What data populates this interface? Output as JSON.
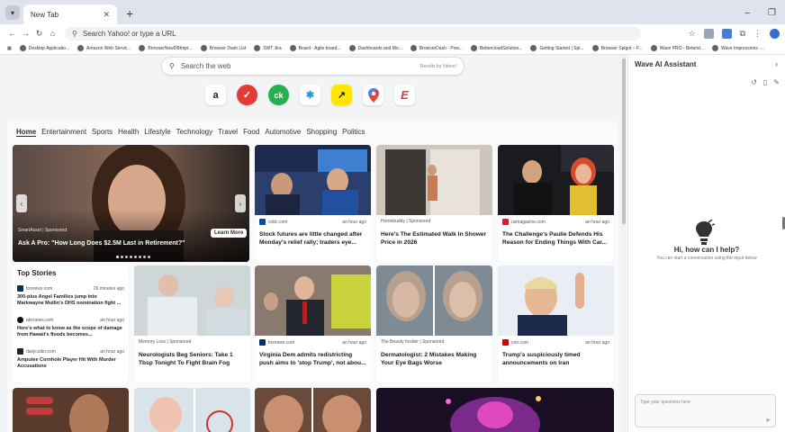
{
  "browser": {
    "tab_title": "New Tab",
    "address_placeholder": "Search Yahoo! or type a URL"
  },
  "bookmarks": [
    "Desktop Applicatio...",
    "Amazon Web Servic...",
    "BrowserNewDBImpr...",
    "Browser Dash List",
    "SWT Jira",
    "Board - Agile board...",
    "Dashboards and Mo...",
    "BrowserDash - Pow...",
    "BettercloudSolution...",
    "Getting Started | Spl...",
    "Browser Spigot – F...",
    "Wave PRO - Betend...",
    "Wave Impressions -..."
  ],
  "search": {
    "placeholder": "Search the web",
    "results_by": "Results by Yahoo!"
  },
  "shortcuts": [
    {
      "name": "amazon",
      "glyph": "a",
      "color": "#111111"
    },
    {
      "name": "todoist",
      "glyph": "✓",
      "color": "#ffffff"
    },
    {
      "name": "checkmate",
      "glyph": "ck",
      "color": "#ffffff"
    },
    {
      "name": "walmart",
      "glyph": "✱",
      "color": "#1a9ad6"
    },
    {
      "name": "arrow-app",
      "glyph": "↗",
      "color": "#111111"
    },
    {
      "name": "google-maps",
      "glyph": "⬤",
      "color": "#34a853"
    },
    {
      "name": "e-app",
      "glyph": "E",
      "color": "#e53935"
    }
  ],
  "categories": [
    "Home",
    "Entertainment",
    "Sports",
    "Health",
    "Lifestyle",
    "Technology",
    "Travel",
    "Food",
    "Automotive",
    "Shopping",
    "Politics"
  ],
  "hero": {
    "source": "SmartAsset | Sponsored",
    "title": "Ask A Pro: \"How Long Does $2.5M Last in Retirement?\"",
    "button": "Learn More"
  },
  "cards_row1": [
    {
      "source": "cnbc.com",
      "time": "an hour ago",
      "title": "Stock futures are little changed after Monday's relief rally; traders eye..."
    },
    {
      "source": "Homebuddy | Sponsored",
      "time": "",
      "title": "Here's The Estimated Walk In Shower Price in 2026"
    },
    {
      "source": "usmagazine.com",
      "time": "an hour ago",
      "title": "The Challenge's Paulie Defends His Reason for Ending Things With Car..."
    }
  ],
  "top_stories": {
    "title": "Top Stories",
    "items": [
      {
        "source": "foxnews.com",
        "time": "26 minutes ago",
        "title": "300-plus Angel Families jump into Markwayne Mullin's DHS nomination fight ..."
      },
      {
        "source": "abcnews.com",
        "time": "an hour ago",
        "title": "Here's what to know as the scope of damage from Hawaii's floods becomes..."
      },
      {
        "source": "dailycaller.com",
        "time": "an hour ago",
        "title": "Amputee Cornhole Player Hit With Murder Accusations"
      }
    ]
  },
  "cards_row2": [
    {
      "source": "Memory Loss | Sponsored",
      "time": "",
      "title": "Neurologists Beg Seniors: Take 1 Tbsp Tonight To Fight Brain Fog"
    },
    {
      "source": "foxnews.com",
      "time": "an hour ago",
      "title": "Virginia Dem admits redistricting push aims to 'stop Trump', not abou..."
    },
    {
      "source": "The Beauty Insider | Sponsored",
      "time": "",
      "title": "Dermatologist: 2 Mistakes Making Your Eye Bags Worse"
    },
    {
      "source": "cnn.com",
      "time": "an hour ago",
      "title": "Trump's suspiciously timed announcements on Iran"
    }
  ],
  "panel": {
    "title": "Wave AI Assistant",
    "greeting": "Hi, how can I help?",
    "subtitle": "You can start a conversation using the input below",
    "input_placeholder": "Type your questions here"
  }
}
